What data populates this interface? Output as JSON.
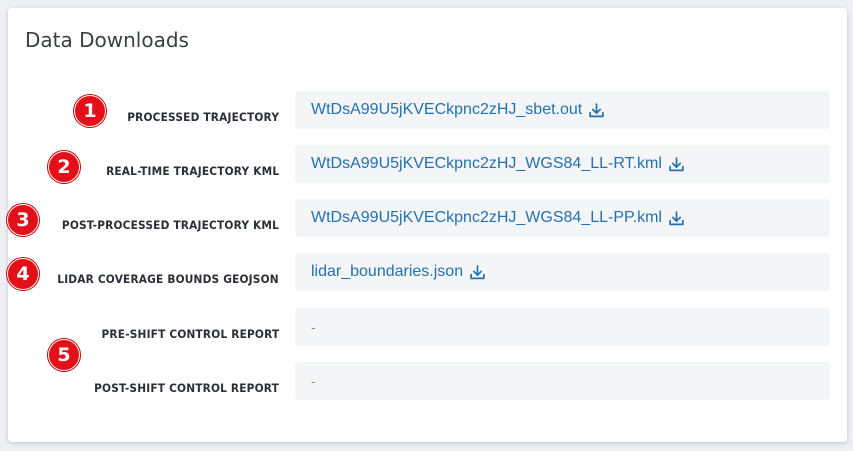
{
  "card": {
    "title": "Data Downloads"
  },
  "rows": [
    {
      "label": "PROCESSED TRAJECTORY",
      "value": "WtDsA99U5jKVECkpnc2zHJ_sbet.out",
      "has_download": true
    },
    {
      "label": "REAL-TIME TRAJECTORY KML",
      "value": "WtDsA99U5jKVECkpnc2zHJ_WGS84_LL-RT.kml",
      "has_download": true
    },
    {
      "label": "POST-PROCESSED TRAJECTORY KML",
      "value": "WtDsA99U5jKVECkpnc2zHJ_WGS84_LL-PP.kml",
      "has_download": true
    },
    {
      "label": "LIDAR COVERAGE BOUNDS GEOJSON",
      "value": "lidar_boundaries.json",
      "has_download": true
    },
    {
      "label": "PRE-SHIFT CONTROL REPORT",
      "value": "-",
      "has_download": false
    },
    {
      "label": "POST-SHIFT CONTROL REPORT",
      "value": "-",
      "has_download": false
    }
  ],
  "badges": [
    "1",
    "2",
    "3",
    "4",
    "5"
  ],
  "icons": {
    "download": "download-icon"
  },
  "colors": {
    "link": "#2271b1",
    "badge": "#e3101a",
    "row_bg": "#f4f5f7"
  }
}
